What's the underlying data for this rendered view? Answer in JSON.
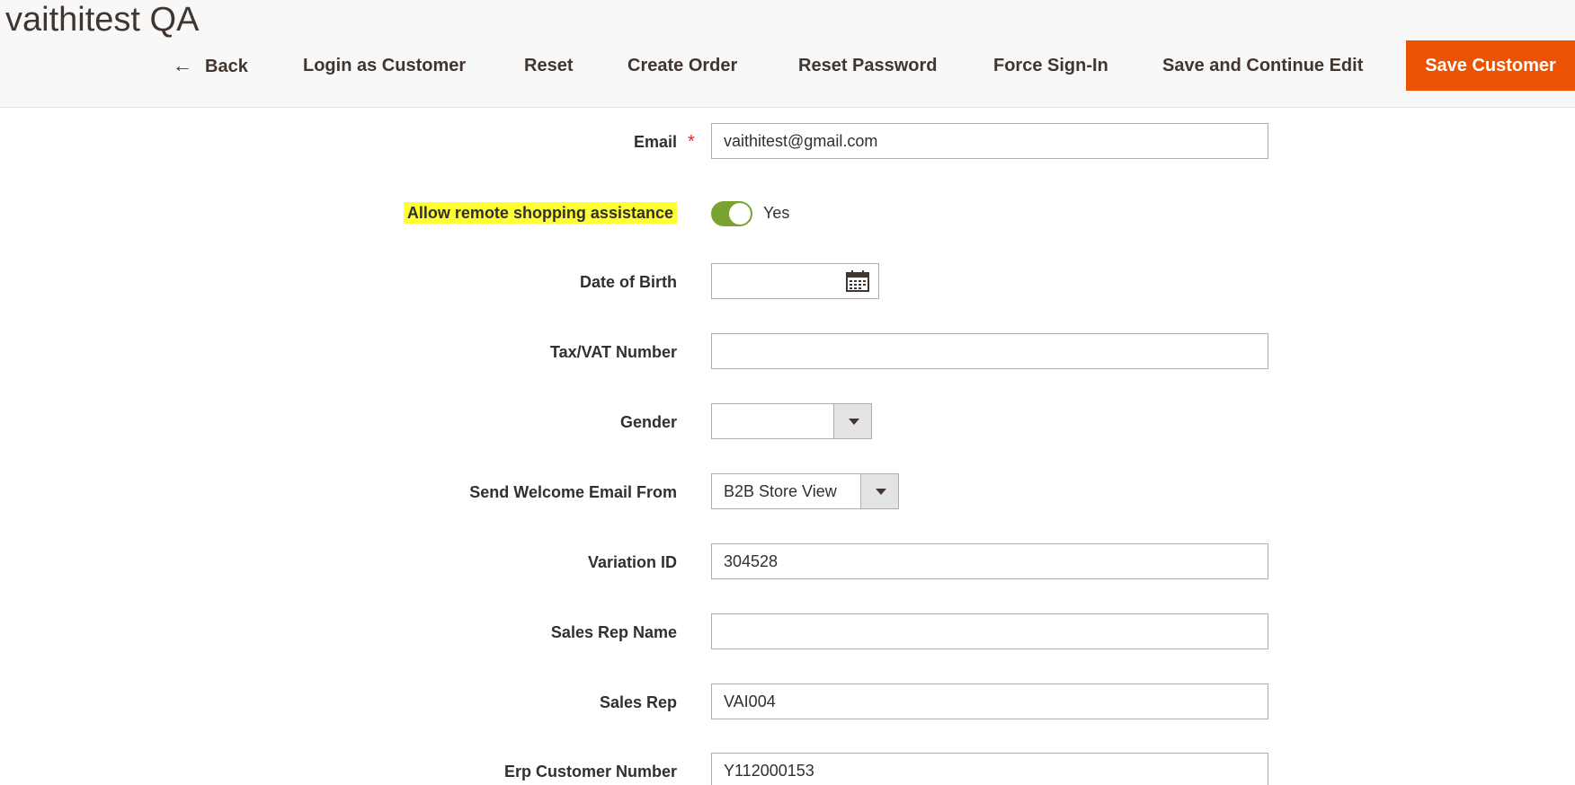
{
  "header": {
    "title": "vaithitest QA",
    "buttons": {
      "back": "Back",
      "login_as_customer": "Login as Customer",
      "reset": "Reset",
      "create_order": "Create Order",
      "reset_password": "Reset Password",
      "force_sign_in": "Force Sign-In",
      "save_continue": "Save and Continue Edit",
      "save_customer": "Save Customer"
    }
  },
  "form": {
    "email": {
      "label": "Email",
      "required_mark": "*",
      "value": "vaithitest@gmail.com"
    },
    "remote_assistance": {
      "label": "Allow remote shopping assistance",
      "state_label": "Yes"
    },
    "dob": {
      "label": "Date of Birth",
      "value": ""
    },
    "taxvat": {
      "label": "Tax/VAT Number",
      "value": ""
    },
    "gender": {
      "label": "Gender",
      "value": ""
    },
    "welcome_email": {
      "label": "Send Welcome Email From",
      "value": "B2B Store View"
    },
    "variation_id": {
      "label": "Variation ID",
      "value": "304528"
    },
    "sales_rep_name": {
      "label": "Sales Rep Name",
      "value": ""
    },
    "sales_rep": {
      "label": "Sales Rep",
      "value": "VAI004"
    },
    "erp_customer_number": {
      "label": "Erp Customer Number",
      "value": "Y112000153"
    }
  },
  "colors": {
    "primary_button": "#eb5202",
    "toggle_on": "#79a22e",
    "highlight": "#ffff33",
    "required": "#e22626"
  }
}
